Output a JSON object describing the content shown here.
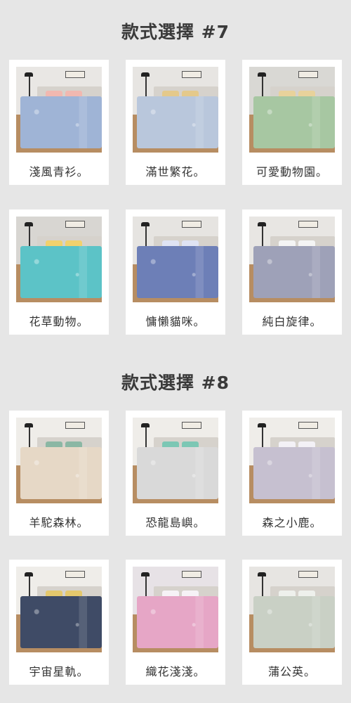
{
  "sections": [
    {
      "title": "款式選擇 #7",
      "items": [
        {
          "caption": "淺風青衫。",
          "bed_color": "#9fb4d6",
          "wall_color": "#e9e7e4",
          "accent": "#f1b8b0"
        },
        {
          "caption": "滿世繁花。",
          "bed_color": "#b9c7dc",
          "wall_color": "#e7e5e2",
          "accent": "#e4c98b"
        },
        {
          "caption": "可愛動物園。",
          "bed_color": "#a7c7a2",
          "wall_color": "#d9d8d4",
          "accent": "#e8d29b"
        },
        {
          "caption": "花草動物。",
          "bed_color": "#5cc3c7",
          "wall_color": "#d8d6d2",
          "accent": "#f2d16d"
        },
        {
          "caption": "慵懶貓咪。",
          "bed_color": "#6d7fb7",
          "wall_color": "#e6e4e1",
          "accent": "#dfe3f3"
        },
        {
          "caption": "純白旋律。",
          "bed_color": "#9ea1b8",
          "wall_color": "#e8e6e3",
          "accent": "#f4f4f4"
        }
      ]
    },
    {
      "title": "款式選擇 #8",
      "items": [
        {
          "caption": "羊駝森林。",
          "bed_color": "#e6d8c6",
          "wall_color": "#efede9",
          "accent": "#8bb7a4"
        },
        {
          "caption": "恐龍島嶼。",
          "bed_color": "#d9d9d9",
          "wall_color": "#efede9",
          "accent": "#7cc7b4"
        },
        {
          "caption": "森之小鹿。",
          "bed_color": "#c6c0d0",
          "wall_color": "#efede9",
          "accent": "#f3f1f6"
        },
        {
          "caption": "宇宙星軌。",
          "bed_color": "#3f4b66",
          "wall_color": "#efede9",
          "accent": "#e4c86d"
        },
        {
          "caption": "織花淺淺。",
          "bed_color": "#e6a6c6",
          "wall_color": "#e7e2e6",
          "accent": "#f6f2f6"
        },
        {
          "caption": "蒲公英。",
          "bed_color": "#c9d0c5",
          "wall_color": "#e7e5e2",
          "accent": "#eef0ec"
        }
      ]
    }
  ]
}
